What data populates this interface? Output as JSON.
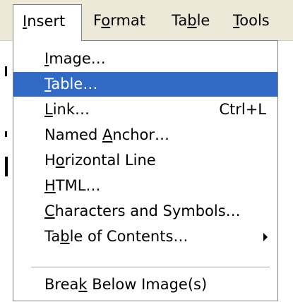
{
  "menubar": {
    "items": [
      {
        "label_pre": "",
        "mnemonic": "I",
        "label_post": "nsert"
      },
      {
        "label_pre": "F",
        "mnemonic": "o",
        "label_post": "rmat"
      },
      {
        "label_pre": "Ta",
        "mnemonic": "b",
        "label_post": "le"
      },
      {
        "label_pre": "",
        "mnemonic": "T",
        "label_post": "ools"
      }
    ]
  },
  "menu": {
    "items": [
      {
        "label_pre": "",
        "mnemonic": "I",
        "label_post": "mage…",
        "shortcut": "",
        "submenu": false,
        "selected": false
      },
      {
        "label_pre": "",
        "mnemonic": "T",
        "label_post": "able…",
        "shortcut": "",
        "submenu": false,
        "selected": true
      },
      {
        "label_pre": "",
        "mnemonic": "L",
        "label_post": "ink…",
        "shortcut": "Ctrl+L",
        "submenu": false,
        "selected": false
      },
      {
        "label_pre": "Named ",
        "mnemonic": "A",
        "label_post": "nchor…",
        "shortcut": "",
        "submenu": false,
        "selected": false
      },
      {
        "label_pre": "H",
        "mnemonic": "o",
        "label_post": "rizontal Line",
        "shortcut": "",
        "submenu": false,
        "selected": false
      },
      {
        "label_pre": "",
        "mnemonic": "H",
        "label_post": "TML…",
        "shortcut": "",
        "submenu": false,
        "selected": false
      },
      {
        "label_pre": "",
        "mnemonic": "C",
        "label_post": "haracters and Symbols…",
        "shortcut": "",
        "submenu": false,
        "selected": false
      },
      {
        "label_pre": "Ta",
        "mnemonic": "b",
        "label_post": "le of Contents…",
        "shortcut": "",
        "submenu": true,
        "selected": false
      }
    ],
    "after_separator": [
      {
        "label_pre": "Brea",
        "mnemonic": "k",
        "label_post": " Below Image(s)",
        "shortcut": "",
        "submenu": false,
        "selected": false
      }
    ]
  },
  "colors": {
    "selection": "#316ac5",
    "menubar_bg": "#ece9d8"
  }
}
